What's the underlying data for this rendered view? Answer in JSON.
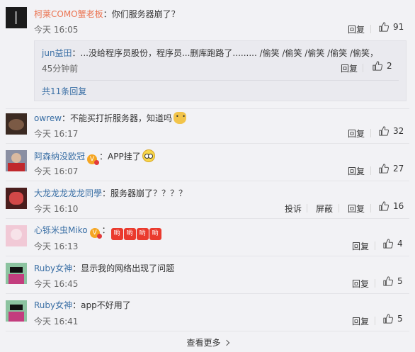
{
  "actions": {
    "reply": "回复",
    "report": "投诉",
    "block": "屏蔽"
  },
  "comments": [
    {
      "user": "柯莱COMO蟹老板",
      "text": "：你们服务器崩了？",
      "time": "今天 16:05",
      "likes": "91"
    },
    {
      "user": "owrew",
      "text": "：不能买打折服务器，知道吗",
      "time": "今天 16:17",
      "likes": "32"
    },
    {
      "user": "阿森纳没欧冠",
      "text": "：APP挂了",
      "time": "今天 16:07",
      "likes": "27"
    },
    {
      "user": "大龙龙龙龙龙同學",
      "text": "：服务器崩了？？？？",
      "time": "今天 16:10",
      "likes": "16"
    },
    {
      "user": "心铄米虫Miko",
      "text": "：",
      "tags": [
        "哟",
        "哟",
        "哟",
        "哟"
      ],
      "time": "今天 16:13",
      "likes": "4"
    },
    {
      "user": "Ruby女神",
      "text": "：显示我的网络出现了问题",
      "time": "今天 16:45",
      "likes": "5"
    },
    {
      "user": "Ruby女神",
      "text": "：app不好用了",
      "time": "今天 16:41",
      "likes": "5"
    }
  ],
  "reply": {
    "user": "jun益田",
    "text": "：...没给程序员股份，程序员...删库跑路了......... /偷笑 /偷笑 /偷笑 /偷笑 /偷笑，",
    "time": "45分钟前",
    "likes": "2",
    "total_label": "共11条回复"
  },
  "load_more": "查看更多"
}
